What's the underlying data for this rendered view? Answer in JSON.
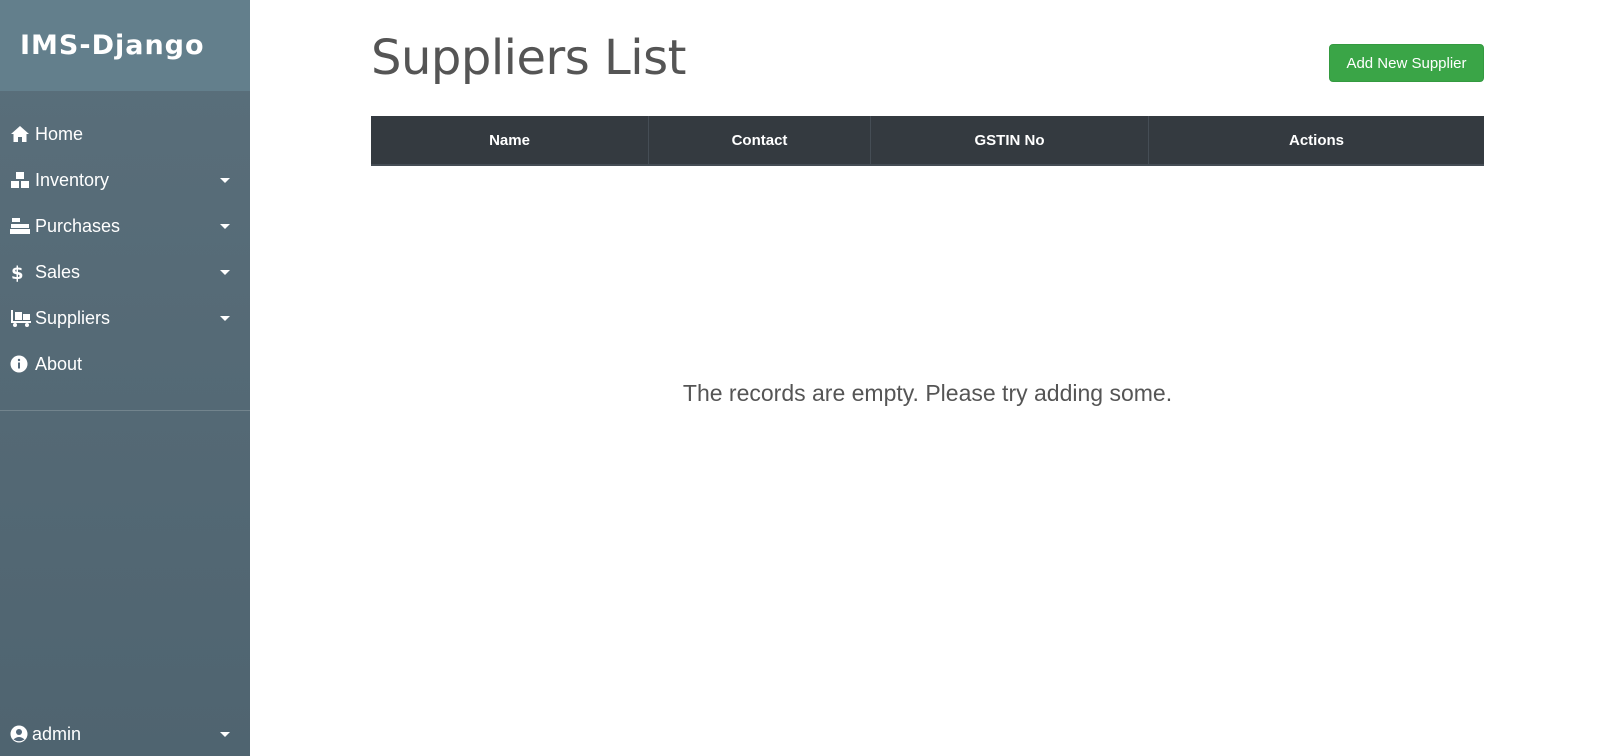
{
  "brand": {
    "title": "IMS-Django"
  },
  "sidebar": {
    "items": [
      {
        "label": "Home",
        "icon": "home-icon",
        "has_dropdown": false
      },
      {
        "label": "Inventory",
        "icon": "boxes-icon",
        "has_dropdown": true
      },
      {
        "label": "Purchases",
        "icon": "cash-register-icon",
        "has_dropdown": true
      },
      {
        "label": "Sales",
        "icon": "dollar-icon",
        "has_dropdown": true
      },
      {
        "label": "Suppliers",
        "icon": "dolly-icon",
        "has_dropdown": true
      },
      {
        "label": "About",
        "icon": "info-circle-icon",
        "has_dropdown": false
      }
    ],
    "user": {
      "label": "admin",
      "icon": "user-circle-icon"
    }
  },
  "main": {
    "title": "Suppliers List",
    "add_button_label": "Add New Supplier",
    "table": {
      "columns": [
        "Name",
        "Contact",
        "GSTIN No",
        "Actions"
      ],
      "rows": []
    },
    "empty_message": "The records are empty. Please try adding some."
  },
  "colors": {
    "sidebar_bg": "#53687a",
    "brand_bg": "#637f8c",
    "table_header_bg": "#343a40",
    "add_button_bg": "#3aa547"
  }
}
